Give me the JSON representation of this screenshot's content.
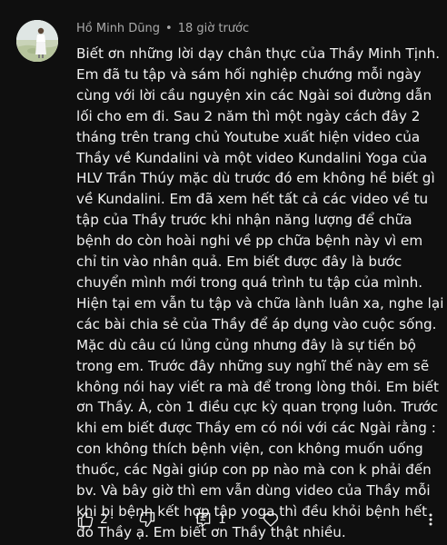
{
  "comment": {
    "author": "Hồ Minh Dũng",
    "separator": "•",
    "time": "18 giờ trước",
    "lines": [
      "Biết ơn những lời dạy chân thực của Thầy Minh Tịnh.",
      "Em đã tu tập và sám hối nghiệp chướng mỗi ngày",
      "cùng với lời cầu nguyện xin các Ngài soi đường dẫn",
      "lối cho em đi. Sau 2 năm thì một ngày cách đây 2",
      "tháng trên trang chủ Youtube xuất hiện video của",
      "Thầy về Kundalini và một video Kundalini Yoga của",
      "HLV Trần Thúy mặc dù trước đó em không hề biết gì",
      "về Kundalini. Em đã xem hết tất cả các video về tu",
      "tập của Thầy trước khi nhận năng lượng để chữa",
      "bệnh do còn hoài nghi về pp chữa bệnh này vì em",
      "chỉ tin vào nhân quả. Em biết được đây là bước",
      "chuyển mình mới trong quá trình tu tập của mình.",
      "Hiện tại em vẫn tu tập và chữa lành luân xa, nghe lại",
      "các bài chia sẻ của Thầy để áp dụng vào cuộc sống.",
      "Mặc dù câu cú lủng củng nhưng đây là sự tiến bộ",
      "trong em. Trước đây những suy nghĩ thế này em sẽ",
      "không nói hay viết ra mà để trong lòng thôi. Em biết",
      "ơn Thầy. À, còn 1 điều cực kỳ quan trọng luôn. Trước",
      "khi em biết được Thầy em có nói với các Ngài rằng :",
      "con không thích bệnh viện, con không muốn uống",
      "thuốc, các Ngài giúp con pp nào mà con k phải đến",
      "bv. Và bây giờ thì em vẫn dùng video của Thầy mỗi",
      "khi bị bệnh kết hợp tập yoga thì đều khỏi bệnh hết",
      "đó Thầy ạ. Em biết ơn Thầy thật nhiều."
    ],
    "likes": "2",
    "replies": "1"
  },
  "icons": {
    "like": "thumbs-up-icon",
    "dislike": "thumbs-down-icon",
    "reply": "reply-comment-icon",
    "heart": "heart-icon",
    "more": "more-vertical-icon"
  },
  "colors": {
    "background": "#0f0f0f",
    "text": "#f1f1f1",
    "meta": "#aaaaaa"
  }
}
